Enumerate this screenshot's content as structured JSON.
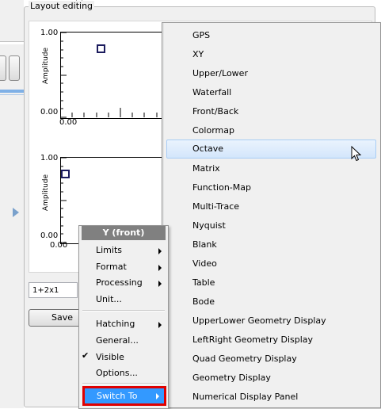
{
  "group": {
    "title": "Layout editing"
  },
  "plot_top": {
    "y_max": "1.00",
    "y_min": "0.00",
    "x_min": "0.00",
    "ylabel": "Amplitude"
  },
  "plot_bottom": {
    "y_max": "1.00",
    "y_min": "0.00",
    "x_min": "0.00",
    "ylabel": "Amplitude"
  },
  "layout_field": {
    "value": "1+2x1"
  },
  "save_button": {
    "label": "Save"
  },
  "context_menu": {
    "header": "Y (front)",
    "items": [
      {
        "label": "Limits",
        "submenu": true
      },
      {
        "label": "Format",
        "submenu": true
      },
      {
        "label": "Processing",
        "submenu": true
      },
      {
        "label": "Unit...",
        "submenu": false
      },
      {
        "label": "Hatching",
        "submenu": true
      },
      {
        "label": "General...",
        "submenu": false
      },
      {
        "label": "Visible",
        "submenu": false,
        "checked": true
      },
      {
        "label": "Options...",
        "submenu": false
      },
      {
        "label": "Switch To",
        "submenu": true,
        "highlighted": true
      }
    ]
  },
  "switch_to_menu": {
    "items": [
      "GPS",
      "XY",
      "Upper/Lower",
      "Waterfall",
      "Front/Back",
      "Colormap",
      "Octave",
      "Matrix",
      "Function-Map",
      "Multi-Trace",
      "Nyquist",
      "Blank",
      "Video",
      "Table",
      "Bode",
      "UpperLower Geometry Display",
      "LeftRight Geometry Display",
      "Quad Geometry Display",
      "Geometry Display",
      "Numerical Display Panel"
    ],
    "hovered": "Octave"
  },
  "colors": {
    "menu_highlight": "#3399ff",
    "annotation_box": "#e00000",
    "marker": "#1c1c5e"
  }
}
